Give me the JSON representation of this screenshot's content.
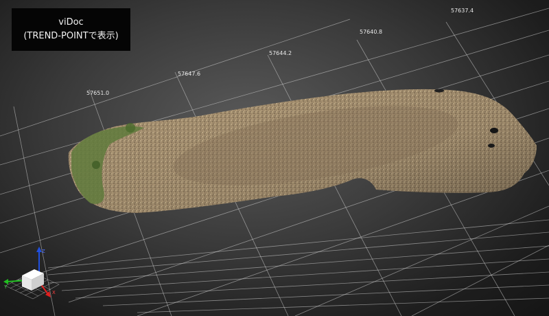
{
  "title": {
    "line1": "viDoc",
    "line2": "(TREND-POINTで表示)"
  },
  "grid": {
    "coord_labels": [
      "57651.0",
      "57647.6",
      "57644.2",
      "57640.8",
      "57637.4"
    ]
  },
  "axis_gizmo": {
    "z_label": "Z",
    "y_label": "Y",
    "x_label": "X",
    "colors": {
      "x": "#e02020",
      "y": "#20c020",
      "z": "#2050e0"
    }
  },
  "colors": {
    "background": "#2b2b2b",
    "grid_line": "#d8d8d8",
    "point_cloud": "#b09a74",
    "vegetation": "#5f7a3c"
  }
}
